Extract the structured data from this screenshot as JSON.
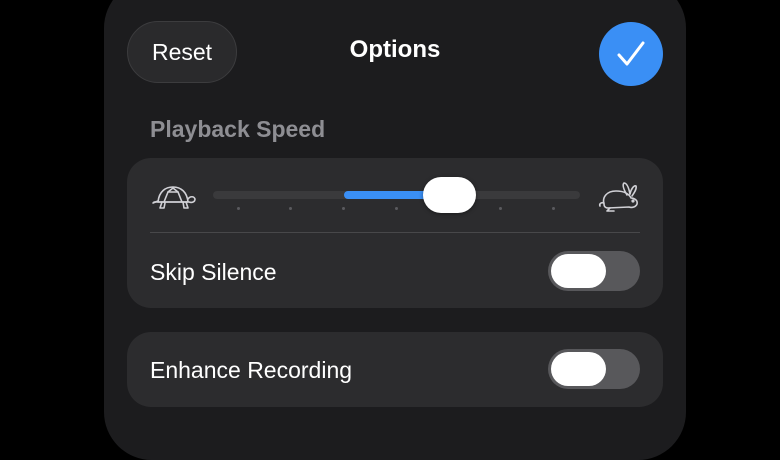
{
  "header": {
    "reset_label": "Reset",
    "title": "Options",
    "done_icon": "checkmark-icon",
    "accent": "#3a8ff5"
  },
  "playback": {
    "section_title": "Playback Speed",
    "slow_icon": "turtle-icon",
    "fast_icon": "rabbit-icon",
    "speed_level": 0.6,
    "tick_count": 7
  },
  "settings": {
    "skip_silence": {
      "label": "Skip Silence",
      "on": false
    },
    "enhance_recording": {
      "label": "Enhance Recording",
      "on": false
    }
  }
}
